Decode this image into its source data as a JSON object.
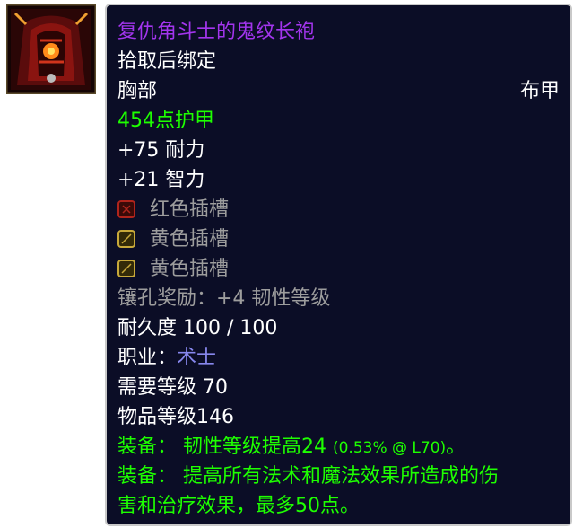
{
  "item": {
    "name": "复仇角斗士的鬼纹长袍",
    "binding": "拾取后绑定",
    "slot": "胸部",
    "armor_type": "布甲",
    "armor": "454点护甲",
    "stats": [
      "+75 耐力",
      "+21 智力"
    ],
    "sockets": [
      {
        "label": "红色插槽",
        "color": "#b0241c"
      },
      {
        "label": "黄色插槽",
        "color": "#c8a93a"
      },
      {
        "label": "黄色插槽",
        "color": "#c8a93a"
      }
    ],
    "socket_bonus": "镶孔奖励：+4 韧性等级",
    "durability": "耐久度 100 / 100",
    "class_label": "职业：",
    "class_value": "术士",
    "required_level": "需要等级 70",
    "item_level": "物品等级146",
    "equip1_prefix": "装备：  韧性等级提高24 ",
    "equip1_detail": "(0.53% @ L70)",
    "equip1_suffix": "。",
    "equip2_line1": "装备：  提高所有法术和魔法效果所造成的伤",
    "equip2_line2": "害和治疗效果，最多50点。"
  },
  "icon": {
    "name": "robe-icon"
  },
  "colors": {
    "background": "#0b0d26",
    "epic": "#a335ee",
    "uncommon": "#1eff00",
    "disabled": "#9d9d9d",
    "warlock": "#8787ed"
  }
}
